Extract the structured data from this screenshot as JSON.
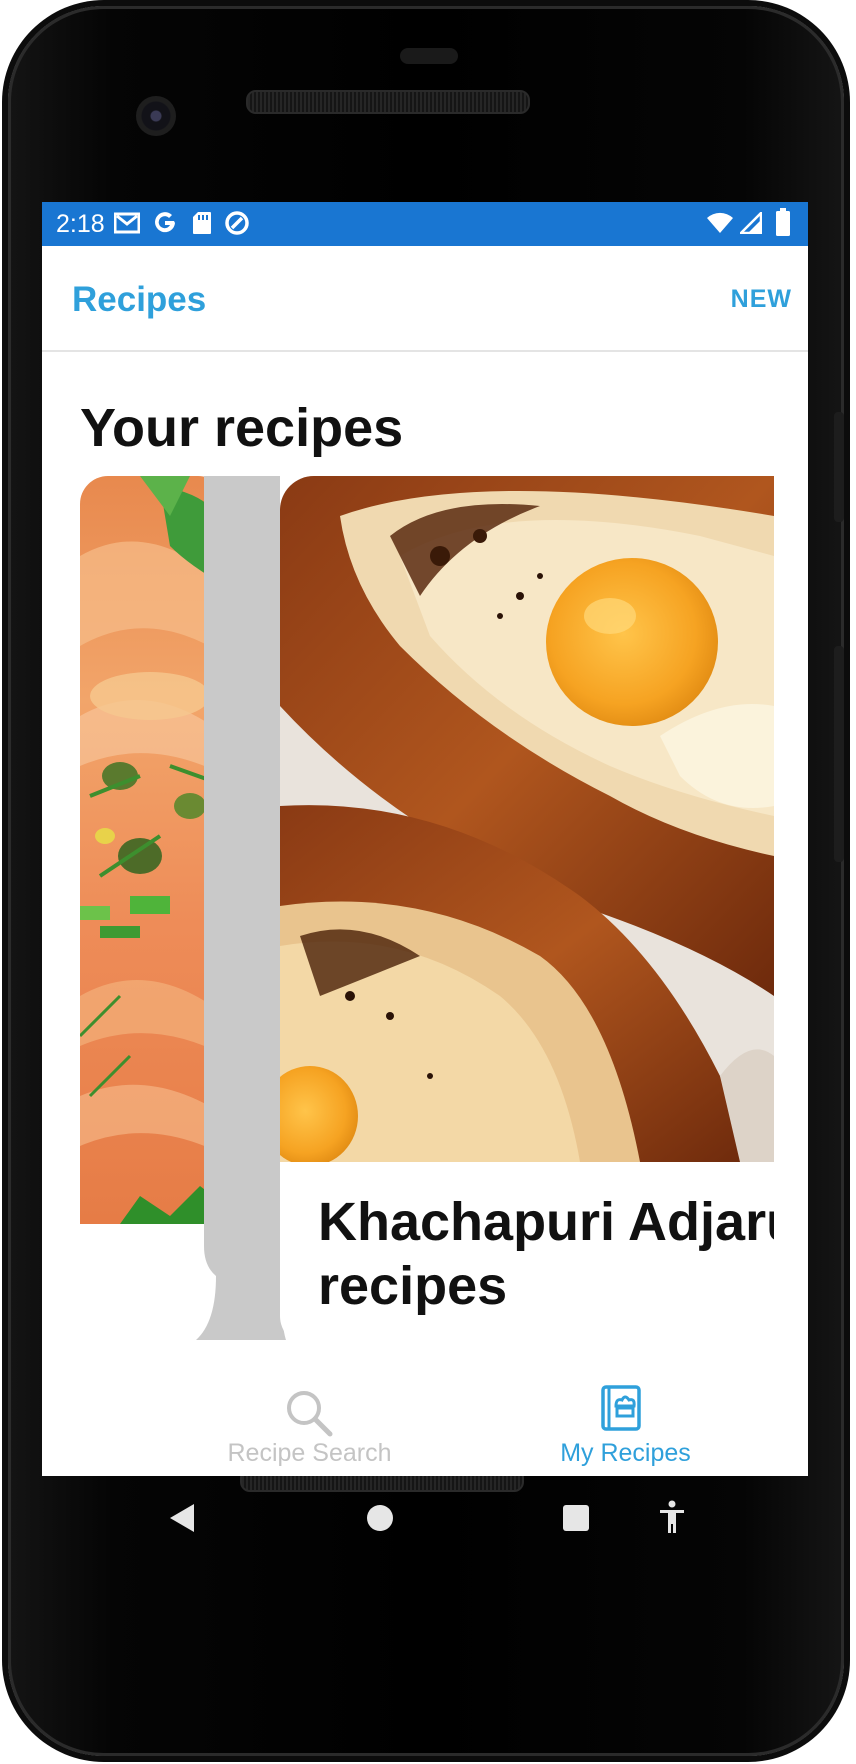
{
  "status_bar": {
    "time": "2:18",
    "background": "#1976d2",
    "left_icons": [
      "gmail-icon",
      "google-icon",
      "sd-card-icon",
      "sync-icon"
    ],
    "right_icons": [
      "wifi-icon",
      "signal-icon",
      "battery-icon"
    ]
  },
  "app_bar": {
    "title": "Recipes",
    "action_label": "NEW",
    "accent": "#2fa0db"
  },
  "main": {
    "section_title": "Your recipes",
    "cards": [
      {
        "title": "",
        "image": "salmon-dish-image"
      },
      {
        "title": "Khachapuri Adjaruli recipes",
        "image": "khachapuri-image"
      }
    ]
  },
  "bottom_nav": {
    "items": [
      {
        "label": "Recipe Search",
        "icon": "search-icon",
        "active": false,
        "color": "#c4c4c4"
      },
      {
        "label": "My Recipes",
        "icon": "recipe-book-icon",
        "active": true,
        "color": "#2fa0db"
      }
    ]
  },
  "system_nav": {
    "buttons": [
      "back-icon",
      "home-icon",
      "recents-icon",
      "accessibility-icon"
    ]
  }
}
